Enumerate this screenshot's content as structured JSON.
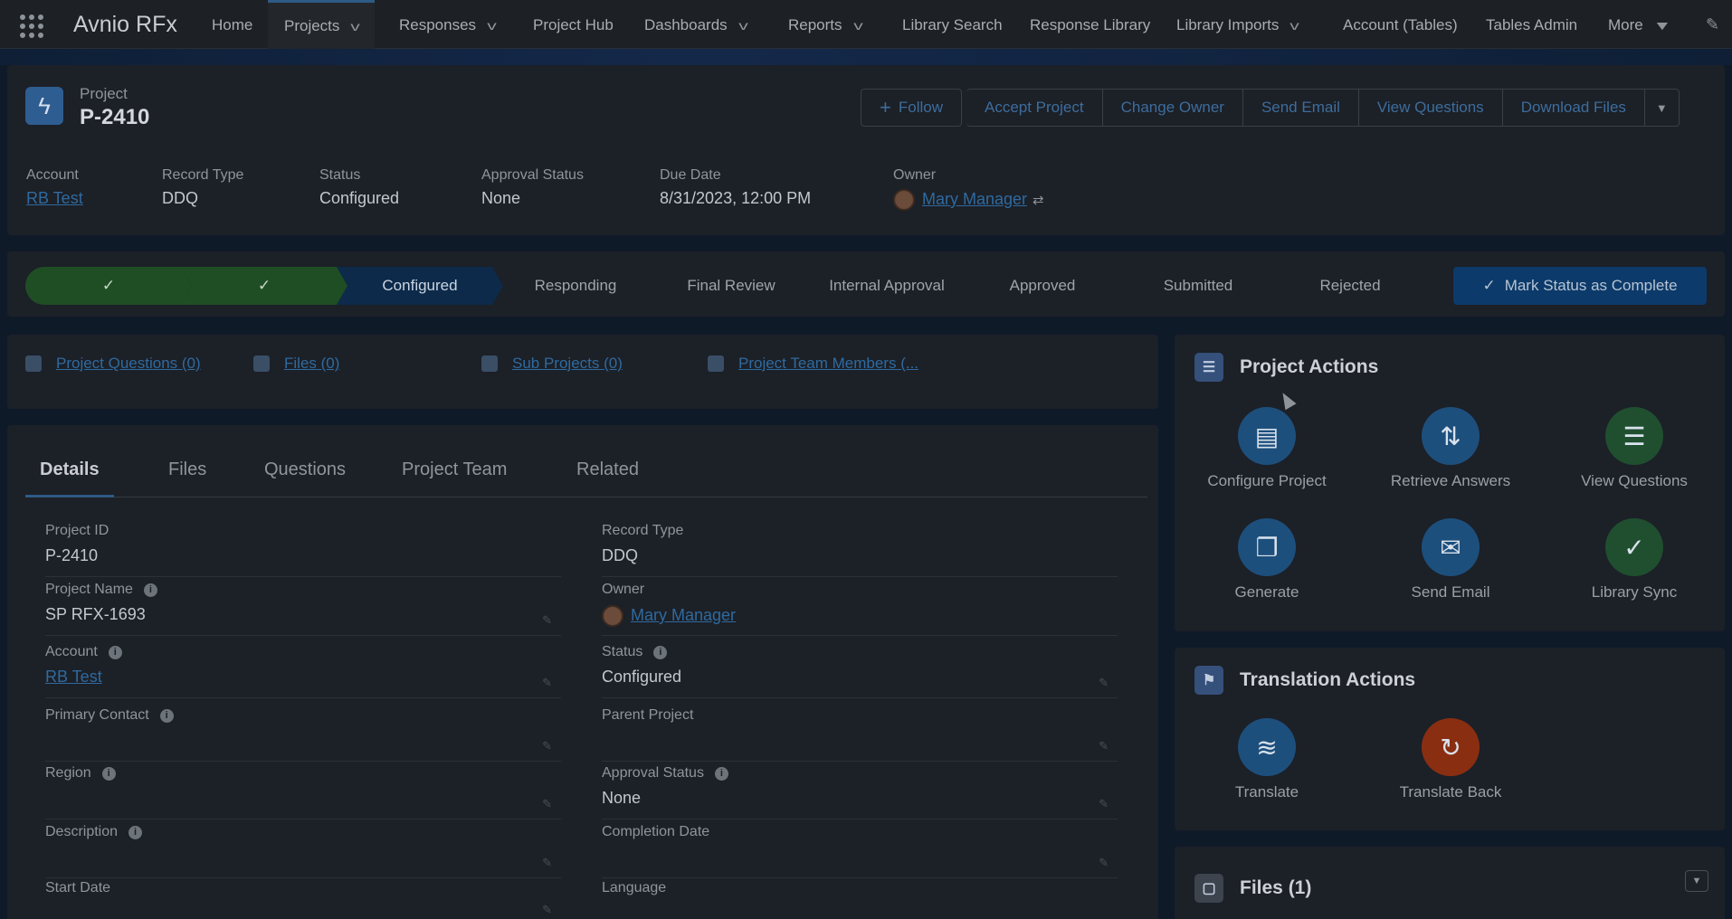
{
  "app": {
    "name": "Avnio RFx"
  },
  "nav": {
    "items": [
      {
        "label": "Home"
      },
      {
        "label": "Projects"
      },
      {
        "label": "Responses"
      },
      {
        "label": "Project Hub"
      },
      {
        "label": "Dashboards"
      },
      {
        "label": "Reports"
      },
      {
        "label": "Library Search"
      },
      {
        "label": "Response Library"
      },
      {
        "label": "Library Imports"
      },
      {
        "label": "Account (Tables)"
      },
      {
        "label": "Tables Admin"
      },
      {
        "label": "More"
      }
    ]
  },
  "record": {
    "type_label": "Project",
    "id": "P-2410",
    "buttons": {
      "follow": "Follow",
      "accept": "Accept Project",
      "change_owner": "Change Owner",
      "send_email": "Send Email",
      "view_questions": "View Questions",
      "download_files": "Download Files"
    },
    "fields": [
      {
        "label": "Account",
        "value": "RB Test"
      },
      {
        "label": "Record Type",
        "value": "DDQ"
      },
      {
        "label": "Status",
        "value": "Configured"
      },
      {
        "label": "Approval Status",
        "value": "None"
      },
      {
        "label": "Due Date",
        "value": "8/31/2023, 12:00 PM"
      },
      {
        "label": "Owner",
        "value": "Mary Manager"
      }
    ]
  },
  "path": {
    "stages": [
      "Configured",
      "Responding",
      "Final Review",
      "Internal Approval",
      "Approved",
      "Submitted",
      "Rejected"
    ],
    "current": "Configured",
    "mark_button": "Mark Status as Complete",
    "check": "✓"
  },
  "related": {
    "links": [
      {
        "label": "Project Questions (0)"
      },
      {
        "label": "Files (0)"
      },
      {
        "label": "Sub Projects (0)"
      },
      {
        "label": "Project Team Members (..."
      }
    ]
  },
  "details": {
    "tabs": [
      "Details",
      "Files",
      "Questions",
      "Project Team",
      "Related"
    ],
    "left_fields": [
      {
        "label": "Project ID",
        "value": "P-2410"
      },
      {
        "label": "Project Name",
        "value": "SP RFX-1693"
      },
      {
        "label": "Account",
        "value": "RB Test"
      },
      {
        "label": "Primary Contact",
        "value": ""
      },
      {
        "label": "Region",
        "value": ""
      },
      {
        "label": "Description",
        "value": ""
      },
      {
        "label": "Start Date",
        "value": ""
      }
    ],
    "right_fields": [
      {
        "label": "Record Type",
        "value": "DDQ"
      },
      {
        "label": "Owner",
        "value": "Mary Manager"
      },
      {
        "label": "Status",
        "value": "Configured"
      },
      {
        "label": "Parent Project",
        "value": ""
      },
      {
        "label": "Approval Status",
        "value": "None"
      },
      {
        "label": "Completion Date",
        "value": ""
      },
      {
        "label": "Language",
        "value": ""
      }
    ],
    "info_glyph": "i"
  },
  "project_actions": {
    "title": "Project Actions",
    "actions": [
      {
        "label": "Configure Project",
        "icon": "configure-icon",
        "color": "#1d4f7d"
      },
      {
        "label": "Retrieve Answers",
        "icon": "retrieve-icon",
        "color": "#1d4f7d"
      },
      {
        "label": "View Questions",
        "icon": "list-icon",
        "color": "#1f4f2f"
      },
      {
        "label": "Generate",
        "icon": "document-icon",
        "color": "#1d4f7d"
      },
      {
        "label": "Send Email",
        "icon": "email-icon",
        "color": "#1d4f7d"
      },
      {
        "label": "Library Sync",
        "icon": "sync-icon",
        "color": "#1f4f2f"
      }
    ]
  },
  "translation_actions": {
    "title": "Translation Actions",
    "actions": [
      {
        "label": "Translate",
        "icon": "translate-icon",
        "color": "#1d4f7d"
      },
      {
        "label": "Translate Back",
        "icon": "undo-icon",
        "color": "#8a2e12"
      }
    ]
  },
  "files_panel": {
    "title": "Files (1)"
  }
}
